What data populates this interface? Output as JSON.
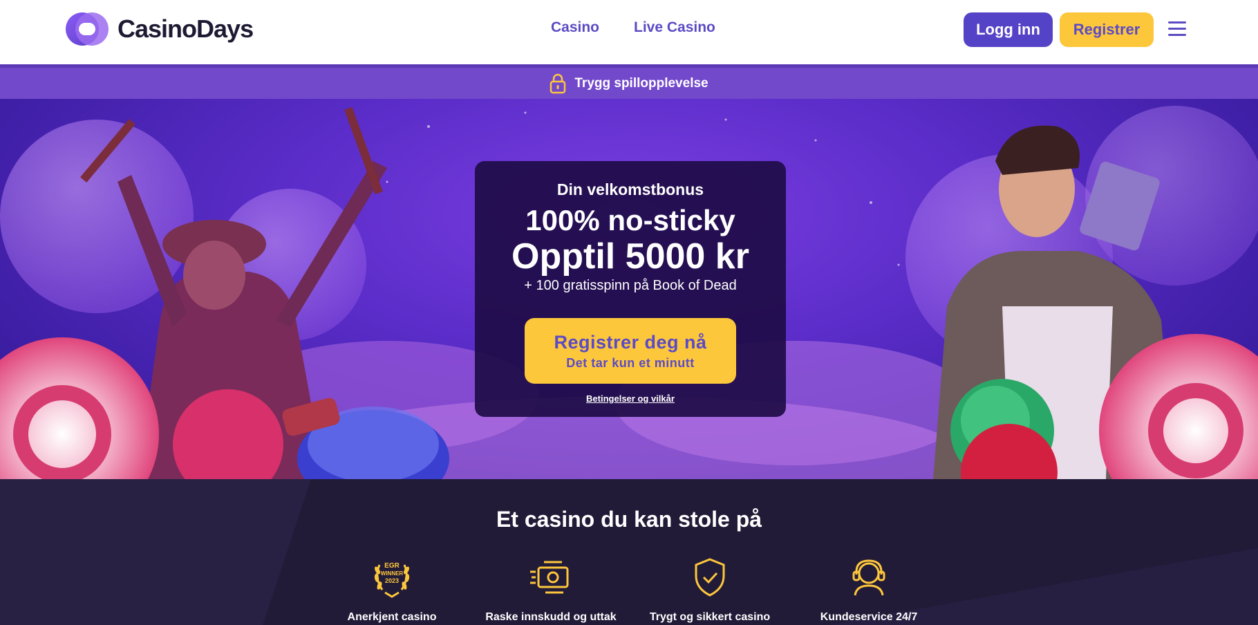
{
  "header": {
    "brand": "CasinoDays",
    "nav": [
      {
        "label": "Casino"
      },
      {
        "label": "Live Casino"
      }
    ],
    "login_label": "Logg inn",
    "register_label": "Registrer"
  },
  "safe_bar": {
    "label": "Trygg spillopplevelse"
  },
  "hero": {
    "kicker": "Din velkomstbonus",
    "headline": "100% no-sticky",
    "amount": "Opptil 5000 kr",
    "subtitle": "+ 100 gratisspinn på Book of Dead",
    "cta_main": "Registrer deg nå",
    "cta_sub": "Det tar kun et minutt",
    "terms": "Betingelser og vilkår"
  },
  "trust": {
    "title": "Et casino du kan stole på",
    "badge_lines": [
      "EGR",
      "WINNER",
      "2023"
    ],
    "features": [
      {
        "label": "Anerkjent casino",
        "icon": "award-laurel-icon"
      },
      {
        "label": "Raske innskudd og uttak",
        "icon": "fast-money-icon"
      },
      {
        "label": "Trygt og sikkert casino",
        "icon": "shield-check-icon"
      },
      {
        "label": "Kundeservice 24/7",
        "icon": "headset-icon"
      }
    ]
  },
  "colors": {
    "brand_purple": "#5543c7",
    "brand_yellow": "#fdc73c",
    "safe_bar": "#7349cc",
    "dark_bg": "#221b38"
  }
}
